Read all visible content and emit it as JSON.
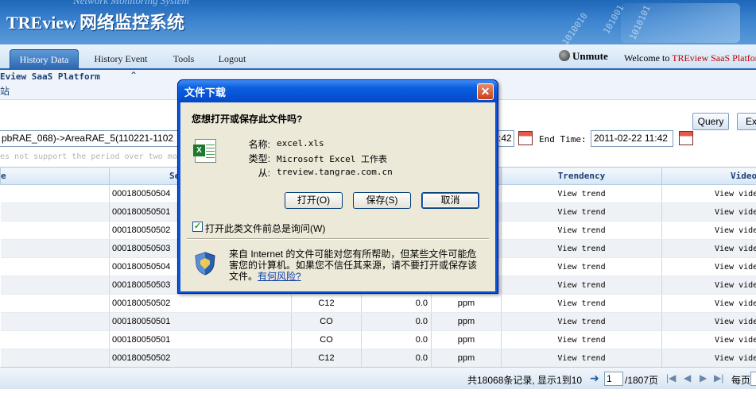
{
  "header": {
    "logo_en": "TREview",
    "logo_cn": "网络监控系统",
    "subtitle": "Network Monitoring System",
    "deco_binary": [
      "1010010",
      "101001",
      "1010101"
    ]
  },
  "nav": {
    "tabs": [
      {
        "label": "History Data",
        "active": true
      },
      {
        "label": "History Event"
      },
      {
        "label": "Tools"
      },
      {
        "label": "Logout"
      }
    ],
    "unmute": "Unmute",
    "welcome_prefix": "Welcome to ",
    "welcome_brand": "TREview SaaS Platfor"
  },
  "platform": {
    "title": "Eview SaaS Platform",
    "sub": "站",
    "collapse": "⌃"
  },
  "query": {
    "query_label": "Query",
    "export_label": "Ex",
    "path": "pbRAE_068)->AreaRAE_5(110221-1102",
    "start_time_fragment": ":42",
    "end_label": "End Time:",
    "end_time": "2011-02-22 11:42",
    "warning": "es not support the period over two mon"
  },
  "table": {
    "headers": [
      "e",
      "Se",
      "",
      "",
      "",
      "Trendency",
      "Video"
    ],
    "rows": [
      {
        "sensor": "000180050504",
        "gas": "",
        "value": "",
        "unit": "",
        "trend": "View trend",
        "video": "View vide"
      },
      {
        "sensor": "000180050501",
        "gas": "",
        "value": "",
        "unit": "",
        "trend": "View trend",
        "video": "View vide"
      },
      {
        "sensor": "000180050502",
        "gas": "",
        "value": "",
        "unit": "",
        "trend": "View trend",
        "video": "View vide"
      },
      {
        "sensor": "000180050503",
        "gas": "",
        "value": "",
        "unit": "",
        "trend": "View trend",
        "video": "View vide"
      },
      {
        "sensor": "000180050504",
        "gas": "",
        "value": "",
        "unit": "",
        "trend": "View trend",
        "video": "View vide"
      },
      {
        "sensor": "000180050503",
        "gas": "",
        "value": "",
        "unit": "",
        "trend": "View trend",
        "video": "View vide"
      },
      {
        "sensor": "000180050502",
        "gas": "C12",
        "value": "0.0",
        "unit": "ppm",
        "trend": "View trend",
        "video": "View vide"
      },
      {
        "sensor": "000180050501",
        "gas": "CO",
        "value": "0.0",
        "unit": "ppm",
        "trend": "View trend",
        "video": "View vide"
      },
      {
        "sensor": "000180050501",
        "gas": "CO",
        "value": "0.0",
        "unit": "ppm",
        "trend": "View trend",
        "video": "View vide"
      },
      {
        "sensor": "000180050502",
        "gas": "C12",
        "value": "0.0",
        "unit": "ppm",
        "trend": "View trend",
        "video": "View vide"
      }
    ]
  },
  "pager": {
    "summary": "共18068条记录, 显示1到10",
    "page": "1",
    "total": "/1807页",
    "per_page": "每页"
  },
  "dialog": {
    "title": "文件下载",
    "question": "您想打开或保存此文件吗?",
    "name_label": "名称:",
    "name_value": "excel.xls",
    "type_label": "类型:",
    "type_value": "Microsoft Excel 工作表",
    "from_label": "从:",
    "from_value": "treview.tangrae.com.cn",
    "open_label": "打开(O)",
    "save_label": "保存(S)",
    "cancel_label": "取消",
    "always_ask_label": "打开此类文件前总是询问(W)",
    "always_ask_checked": true,
    "warning_text": "来自 Internet 的文件可能对您有所帮助，但某些文件可能危害您的计算机。如果您不信任其来源，请不要打开或保存该文件。",
    "risk_link": "有何风险?"
  }
}
